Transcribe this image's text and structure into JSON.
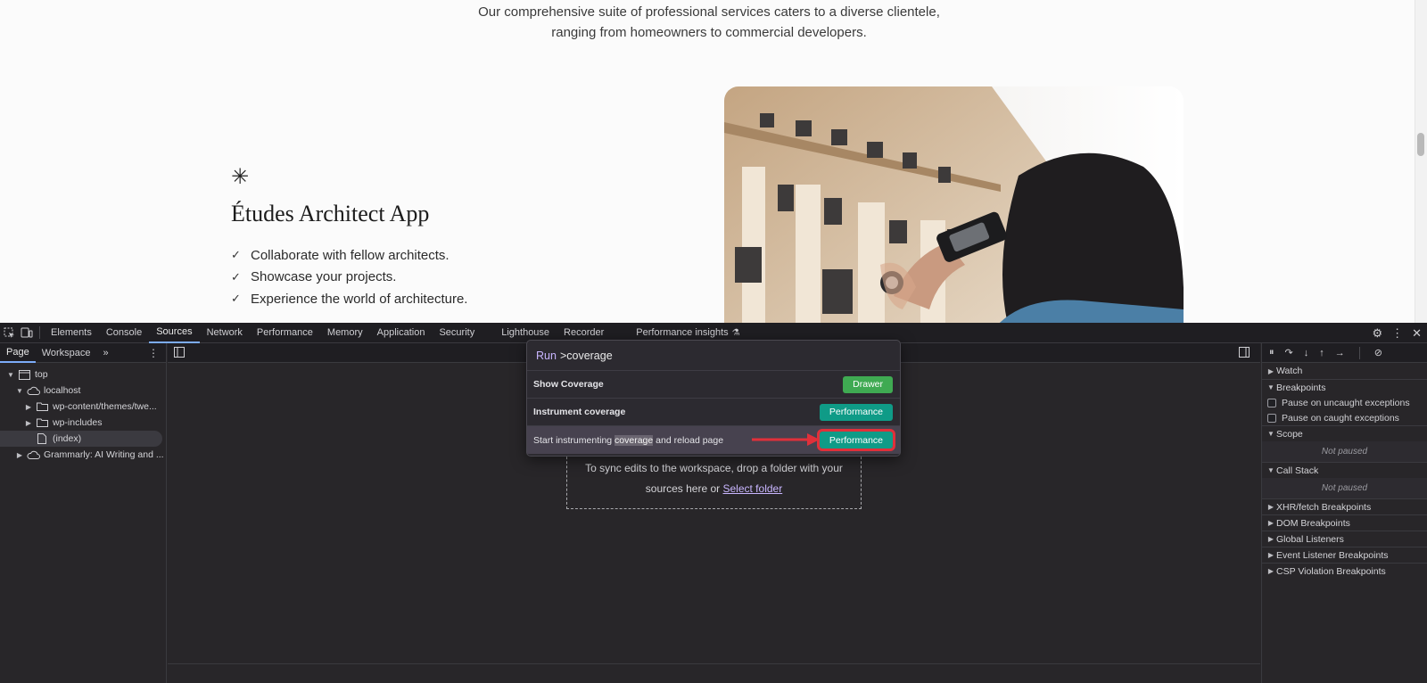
{
  "site": {
    "intro_line1": "Our comprehensive suite of professional services caters to a diverse clientele,",
    "intro_line2": "ranging from homeowners to commercial developers.",
    "feature_title": "Études Architect App",
    "features": [
      "Collaborate with fellow architects.",
      "Showcase your projects.",
      "Experience the world of architecture."
    ]
  },
  "devtools": {
    "tabs": [
      "Elements",
      "Console",
      "Sources",
      "Network",
      "Performance",
      "Memory",
      "Application",
      "Security",
      "Lighthouse",
      "Recorder",
      "Performance insights"
    ],
    "active_tab": "Sources",
    "navigator_tabs": [
      "Page",
      "Workspace"
    ],
    "tree": [
      {
        "label": "top",
        "depth": 0,
        "kind": "frame",
        "expanded": true
      },
      {
        "label": "localhost",
        "depth": 1,
        "kind": "cloud",
        "expanded": true
      },
      {
        "label": "wp-content/themes/twe...",
        "depth": 2,
        "kind": "folder",
        "expanded": false
      },
      {
        "label": "wp-includes",
        "depth": 2,
        "kind": "folder",
        "expanded": false
      },
      {
        "label": "(index)",
        "depth": 2,
        "kind": "file",
        "selected": true
      },
      {
        "label": "Grammarly: AI Writing and ...",
        "depth": 1,
        "kind": "cloud",
        "expanded": false
      }
    ],
    "drop_zone": {
      "line1": "To sync edits to the workspace, drop a folder with your",
      "line2_prefix": "sources here or",
      "link": "Select folder"
    },
    "sidebar": {
      "watch": "Watch",
      "breakpoints": "Breakpoints",
      "pause_uncaught": "Pause on uncaught exceptions",
      "pause_caught": "Pause on caught exceptions",
      "scope": "Scope",
      "not_paused": "Not paused",
      "call_stack": "Call Stack",
      "xhr": "XHR/fetch Breakpoints",
      "dom": "DOM Breakpoints",
      "global": "Global Listeners",
      "event": "Event Listener Breakpoints",
      "csp": "CSP Violation Breakpoints"
    },
    "command_menu": {
      "prefix": "Run",
      "query": ">coverage",
      "items": [
        {
          "label": "Show Coverage",
          "category": "Drawer",
          "color": "#3faa52"
        },
        {
          "label": "Instrument coverage",
          "category": "Performance",
          "color": "#0f9b87"
        },
        {
          "label_before": "Start instrumenting ",
          "label_match": "coverage",
          "label_after": " and reload page",
          "category": "Performance",
          "color": "#0f9b87",
          "highlighted": true
        }
      ]
    }
  }
}
